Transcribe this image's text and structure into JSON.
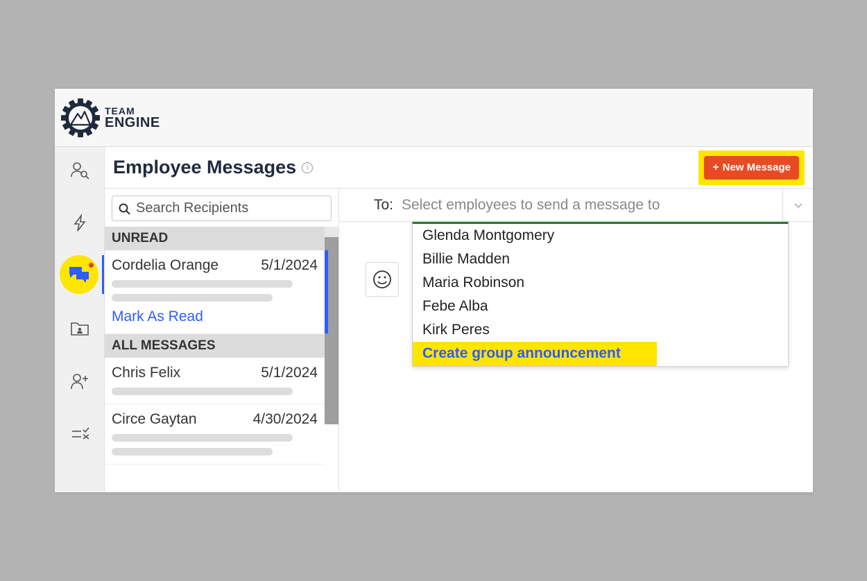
{
  "brand": {
    "line1": "TEAM",
    "line2": "ENGINE"
  },
  "page": {
    "title": "Employee Messages",
    "newMessage": "New Message"
  },
  "search": {
    "placeholder": "Search Recipients"
  },
  "sections": {
    "unread": "UNREAD",
    "all": "ALL MESSAGES"
  },
  "conversations": {
    "unread": [
      {
        "name": "Cordelia Orange",
        "date": "5/1/2024",
        "markRead": "Mark As Read"
      }
    ],
    "all": [
      {
        "name": "Chris Felix",
        "date": "5/1/2024"
      },
      {
        "name": "Circe Gaytan",
        "date": "4/30/2024"
      }
    ]
  },
  "compose": {
    "toLabel": "To:",
    "toPlaceholder": "Select employees to send a message to",
    "options": [
      "Glenda Montgomery",
      "Billie Madden",
      "Maria Robinson",
      "Febe Alba",
      "Kirk Peres"
    ],
    "groupAction": "Create group announcement"
  }
}
